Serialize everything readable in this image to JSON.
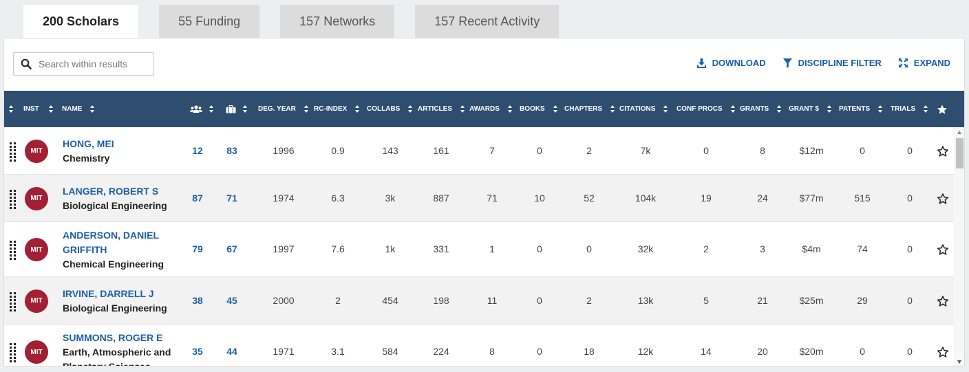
{
  "tabs": [
    {
      "label": "200 Scholars",
      "active": true
    },
    {
      "label": "55 Funding",
      "active": false
    },
    {
      "label": "157 Networks",
      "active": false
    },
    {
      "label": "157 Recent Activity",
      "active": false
    }
  ],
  "toolbar": {
    "search_placeholder": "Search within results",
    "download_label": "DOWNLOAD",
    "filter_label": "DISCIPLINE FILTER",
    "expand_label": "EXPAND"
  },
  "columns": {
    "inst": "INST",
    "name": "NAME",
    "collaborators_icon": "people-icon",
    "portfolio_icon": "briefcase-icon",
    "deg_year": "DEG. YEAR",
    "rc_index": "RC-INDEX",
    "collabs": "COLLABS",
    "articles": "ARTICLES",
    "awards": "AWARDS",
    "books": "BOOKS",
    "chapters": "CHAPTERS",
    "citations": "CITATIONS",
    "conf_procs": "CONF PROCS",
    "grants": "GRANTS",
    "grant_dollars": "GRANT $",
    "patents": "PATENTS",
    "trials": "TRIALS",
    "favorite_icon": "star-icon"
  },
  "colors": {
    "header_bg": "#2f4d6f",
    "link": "#1a5fa8",
    "badge": "#a31f34"
  },
  "rows": [
    {
      "inst": "MIT",
      "name": "HONG, MEI",
      "dept": "Chemistry",
      "c1": "12",
      "c2": "83",
      "deg_year": "1996",
      "rc_index": "0.9",
      "collabs": "143",
      "articles": "161",
      "awards": "7",
      "books": "0",
      "chapters": "2",
      "citations": "7k",
      "conf_procs": "0",
      "grants": "8",
      "grant_dollars": "$12m",
      "patents": "0",
      "trials": "0"
    },
    {
      "inst": "MIT",
      "name": "LANGER, ROBERT S",
      "dept": "Biological Engineering",
      "c1": "87",
      "c2": "71",
      "deg_year": "1974",
      "rc_index": "6.3",
      "collabs": "3k",
      "articles": "887",
      "awards": "71",
      "books": "10",
      "chapters": "52",
      "citations": "104k",
      "conf_procs": "19",
      "grants": "24",
      "grant_dollars": "$77m",
      "patents": "515",
      "trials": "0"
    },
    {
      "inst": "MIT",
      "name": "ANDERSON, DANIEL GRIFFITH",
      "dept": "Chemical Engineering",
      "c1": "79",
      "c2": "67",
      "deg_year": "1997",
      "rc_index": "7.6",
      "collabs": "1k",
      "articles": "331",
      "awards": "1",
      "books": "0",
      "chapters": "0",
      "citations": "32k",
      "conf_procs": "2",
      "grants": "3",
      "grant_dollars": "$4m",
      "patents": "74",
      "trials": "0"
    },
    {
      "inst": "MIT",
      "name": "IRVINE, DARRELL J",
      "dept": "Biological Engineering",
      "c1": "38",
      "c2": "45",
      "deg_year": "2000",
      "rc_index": "2",
      "collabs": "454",
      "articles": "198",
      "awards": "11",
      "books": "0",
      "chapters": "2",
      "citations": "13k",
      "conf_procs": "5",
      "grants": "21",
      "grant_dollars": "$25m",
      "patents": "29",
      "trials": "0"
    },
    {
      "inst": "MIT",
      "name": "SUMMONS, ROGER E",
      "dept": "Earth, Atmospheric and Planetary Sciences",
      "c1": "35",
      "c2": "44",
      "deg_year": "1971",
      "rc_index": "3.1",
      "collabs": "584",
      "articles": "224",
      "awards": "8",
      "books": "0",
      "chapters": "18",
      "citations": "12k",
      "conf_procs": "14",
      "grants": "20",
      "grant_dollars": "$20m",
      "patents": "0",
      "trials": "0"
    }
  ]
}
